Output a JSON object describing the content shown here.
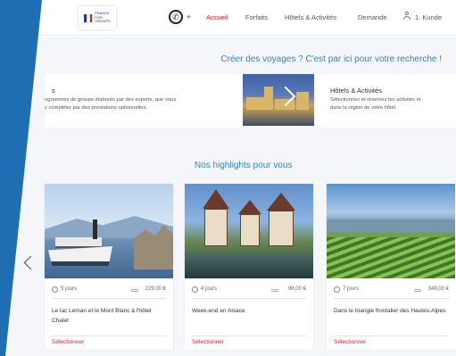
{
  "header": {
    "logo_text": "FRANCE\nFOR\nGROUPS",
    "phone_plus": "+",
    "nav": [
      {
        "label": "Accueil",
        "active": true
      },
      {
        "label": "Forfaits",
        "active": false
      },
      {
        "label": "Hôtels & Activités",
        "active": false
      },
      {
        "label": "Demande",
        "active": false
      },
      {
        "label": "1. Kunde",
        "active": false
      }
    ]
  },
  "headline": "Créer des voyages ? C'est par ici pour votre recherche !",
  "promo_left": {
    "title": "s",
    "desc_line1": "ogrammes de groupe élaborés par des experts, que vous",
    "desc_line2": "z compléter par des prestations optionnelles."
  },
  "promo_right": {
    "title": "Hôtels & Activités",
    "desc_line1": "Sélectionnez et réservez les activités et",
    "desc_line2": "dans la région de votre hôtel."
  },
  "highlights_title": "Nos highlights pour vous",
  "cards": [
    {
      "duration": "5 jours",
      "price": "229,00 €",
      "title": "Le lac Léman et le Mont Blanc à l'hôtel Chalet",
      "action": "Sélectionner"
    },
    {
      "duration": "4 jours",
      "price": "98,00 €",
      "title": "Week-end en Alsace",
      "action": "Sélectionner"
    },
    {
      "duration": "7 jours",
      "price": "349,00 €",
      "title": "Dans le triangle frontalier des Hautes-Alpes",
      "action": "Sélectionner"
    }
  ],
  "colors": {
    "accent_red": "#d9232d",
    "accent_blue": "#2f84c4",
    "band_blue": "#1f6db3"
  }
}
